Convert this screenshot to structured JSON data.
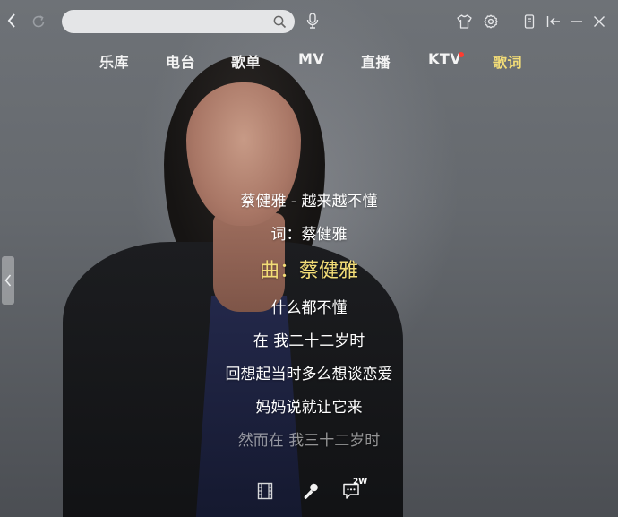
{
  "toolbar": {
    "search": {
      "value": "",
      "placeholder": ""
    }
  },
  "nav": {
    "tabs": [
      {
        "label": "乐库",
        "active": false
      },
      {
        "label": "电台",
        "active": false
      },
      {
        "label": "歌单",
        "active": false
      },
      {
        "label": "MV",
        "active": false
      },
      {
        "label": "直播",
        "active": false
      },
      {
        "label": "KTV",
        "active": false,
        "notification_dot": true
      },
      {
        "label": "歌词",
        "active": true
      }
    ]
  },
  "lyrics": {
    "lines": [
      {
        "text": "蔡健雅 - 越来越不懂",
        "state": "normal"
      },
      {
        "text": "词：蔡健雅",
        "state": "normal"
      },
      {
        "text": "曲：蔡健雅",
        "state": "current"
      },
      {
        "text": "什么都不懂",
        "state": "normal"
      },
      {
        "text": "在 我二十二岁时",
        "state": "normal"
      },
      {
        "text": "回想起当时多么想谈恋爱",
        "state": "normal"
      },
      {
        "text": "妈妈说就让它来",
        "state": "normal"
      },
      {
        "text": "然而在 我三十二岁时",
        "state": "dim"
      }
    ]
  },
  "bottom_controls": {
    "comment_count": "2W"
  },
  "colors": {
    "accent": "#f3dd77",
    "notification": "#ff3b30"
  },
  "icons": [
    "back-arrow-icon",
    "refresh-icon",
    "search-icon",
    "voice-search-icon",
    "skin-icon",
    "settings-icon",
    "mini-mode-icon",
    "sidebar-toggle-icon",
    "minimize-icon",
    "close-icon",
    "collapse-left-icon",
    "mv-film-icon",
    "microphone-icon",
    "comments-icon"
  ]
}
